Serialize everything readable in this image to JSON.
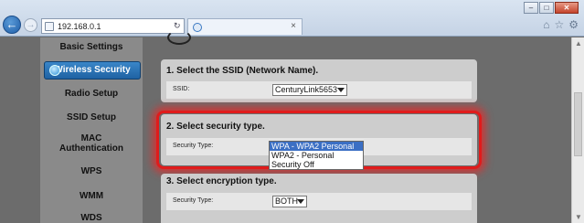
{
  "browser": {
    "url": "192.168.0.1",
    "window_buttons": [
      "‒",
      "□",
      "✕"
    ]
  },
  "sidebar": {
    "items": [
      {
        "label": "Basic Settings"
      },
      {
        "label": "Wireless Security"
      },
      {
        "label": "Radio Setup"
      },
      {
        "label": "SSID Setup"
      },
      {
        "label": "MAC Authentication"
      },
      {
        "label": "WPS"
      },
      {
        "label": "WMM"
      },
      {
        "label": "WDS"
      }
    ],
    "active_item": "Wireless Security"
  },
  "section1": {
    "title": "1. Select the SSID (Network Name).",
    "field_label": "SSID:",
    "value": "CenturyLink5653"
  },
  "section2": {
    "title": "2. Select security type.",
    "field_label": "Security Type:",
    "options": [
      "WPA - WPA2 Personal",
      "WPA2 - Personal",
      "Security Off"
    ],
    "selected": "WPA - WPA2 Personal"
  },
  "section3": {
    "title": "3. Select encryption type.",
    "field_label": "Security Type:",
    "value": "BOTH"
  },
  "colors": {
    "highlight": "#e01b1b",
    "active_nav": "#2a72b5",
    "selected_option": "#3b6fc4"
  }
}
